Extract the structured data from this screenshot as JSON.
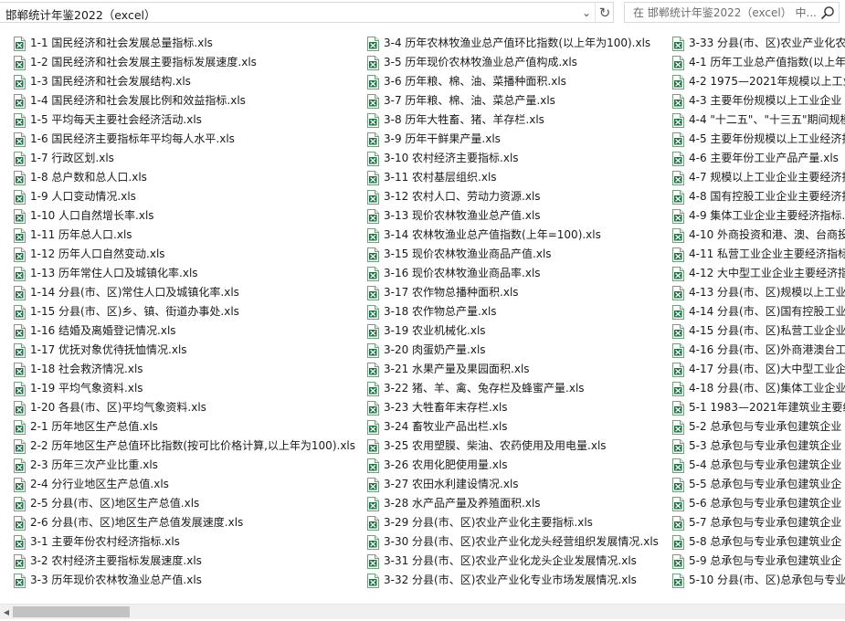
{
  "address_bar": {
    "path": "邯郸统计年鉴2022（excel）",
    "dropdown_glyph": "⌄",
    "refresh_glyph": "↻"
  },
  "search": {
    "placeholder": "在 邯郸统计年鉴2022（excel） 中..."
  },
  "colors": {
    "excel_green": "#1e7145",
    "scrollbar_thumb": "#c2c2c2"
  },
  "icons": {
    "file": "excel-file-icon",
    "search": "search-icon",
    "refresh": "refresh-icon",
    "dropdown": "chevron-down-icon"
  },
  "files": {
    "columns": [
      [
        "1-1 国民经济和社会发展总量指标.xls",
        "1-2 国民经济和社会发展主要指标发展速度.xls",
        "1-3 国民经济和社会发展结构.xls",
        "1-4 国民经济和社会发展比例和效益指标.xls",
        "1-5 平均每天主要社会经济活动.xls",
        "1-6 国民经济主要指标年平均每人水平.xls",
        "1-7 行政区划.xls",
        "1-8 总户数和总人口.xls",
        "1-9 人口变动情况.xls",
        "1-10 人口自然增长率.xls",
        "1-11 历年总人口.xls",
        "1-12 历年人口自然变动.xls",
        "1-13 历年常住人口及城镇化率.xls",
        "1-14 分县(市、区)常住人口及城镇化率.xls",
        "1-15 分县(市、区)乡、镇、街道办事处.xls",
        "1-16 结婚及离婚登记情况.xls",
        "1-17 优抚对象优待抚恤情况.xls",
        "1-18 社会救济情况.xls",
        "1-19 平均气象资料.xls",
        "1-20 各县(市、区)平均气象资料.xls",
        "2-1 历年地区生产总值.xls",
        "2-2 历年地区生产总值环比指数(按可比价格计算,以上年为100).xls",
        "2-3 历年三次产业比重.xls",
        "2-4 分行业地区生产总值.xls",
        "2-5 分县(市、区)地区生产总值.xls",
        "2-6 分县(市、区)地区生产总值发展速度.xls",
        "3-1 主要年份农村经济指标.xls",
        "3-2 农村经济主要指标发展速度.xls",
        "3-3 历年现价农林牧渔业总产值.xls"
      ],
      [
        "3-4 历年农林牧渔业总产值环比指数(以上年为100).xls",
        "3-5 历年现价农林牧渔业总产值构成.xls",
        "3-6 历年粮、棉、油、菜播种面积.xls",
        "3-7 历年粮、棉、油、菜总产量.xls",
        "3-8 历年大牲畜、猪、羊存栏.xls",
        "3-9 历年干鲜果产量.xls",
        "3-10 农村经济主要指标.xls",
        "3-11 农村基层组织.xls",
        "3-12 农村人口、劳动力资源.xls",
        "3-13 现价农林牧渔业总产值.xls",
        "3-14 农林牧渔业总产值指数(上年=100).xls",
        "3-15 现价农林牧渔业商品产值.xls",
        "3-16 现价农林牧渔业商品率.xls",
        "3-17 农作物总播种面积.xls",
        "3-18 农作物总产量.xls",
        "3-19 农业机械化.xls",
        "3-20 肉蛋奶产量.xls",
        "3-21 水果产量及果园面积.xls",
        "3-22 猪、羊、禽、兔存栏及蜂蜜产量.xls",
        "3-23 大牲畜年末存栏.xls",
        "3-24 畜牧业产品出栏.xls",
        "3-25 农用塑膜、柴油、农药使用及用电量.xls",
        "3-26 农用化肥使用量.xls",
        "3-27 农田水利建设情况.xls",
        "3-28 水产品产量及养殖面积.xls",
        "3-29 分县(市、区)农业产业化主要指标.xls",
        "3-30 分县(市、区)农业产业化龙头经营组织发展情况.xls",
        "3-31 分县(市、区)农业产业化龙头企业发展情况.xls",
        "3-32 分县(市、区)农业产业化专业市场发展情况.xls"
      ],
      [
        "3-33 分县(市、区)农业产业化农",
        "4-1 历年工业总产值指数(以上年",
        "4-2 1975—2021年规模以上工业",
        "4-3 主要年份规模以上工业企业",
        "4-4 \"十二五\"、\"十三五\"期间规模",
        "4-5 主要年份规模以上工业经济指",
        "4-6 主要年份工业产品产量.xls",
        "4-7 规模以上工业企业主要经济指",
        "4-8 国有控股工业企业主要经济指",
        "4-9 集体工业企业主要经济指标.x",
        "4-10 外商投资和港、澳、台商投",
        "4-11 私营工业企业主要经济指标",
        "4-12 大中型工业企业主要经济指",
        "4-13 分县(市、区)规模以上工业",
        "4-14 分县(市、区)国有控股工业",
        "4-15 分县(市、区)私营工业企业",
        "4-16 分县(市、区)外商港澳台工",
        "4-17 分县(市、区)大中型工业企",
        "4-18 分县(市、区)集体工业企业",
        "5-1 1983—2021年建筑业主要经",
        "5-2 总承包与专业承包建筑企业",
        "5-3 总承包与专业承包建筑企业",
        "5-4 总承包与专业承包建筑企业",
        "5-5 总承包与专业承包建筑业企",
        "5-6 总承包与专业承包建筑企业",
        "5-7 总承包与专业承包建筑企业",
        "5-8 总承包与专业承包建筑业企",
        "5-9 总承包与专业承包建筑业企",
        "5-10 分县(市、区)总承包与专业"
      ]
    ]
  }
}
